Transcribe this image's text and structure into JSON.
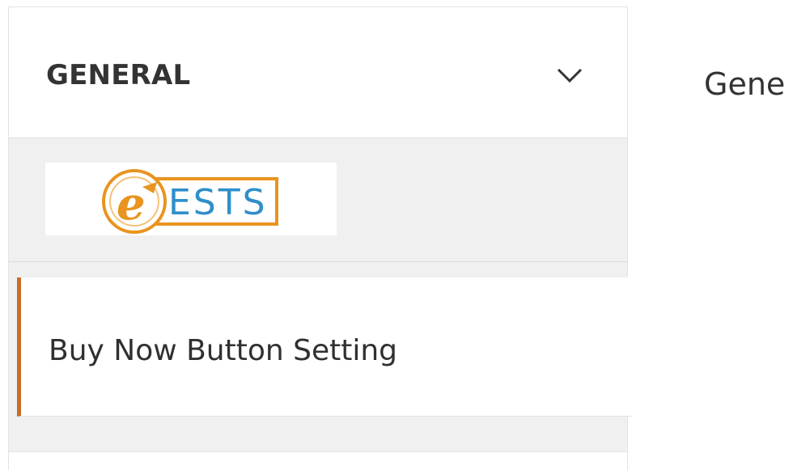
{
  "sidebar": {
    "general_section": {
      "label": "GENERAL",
      "chevron_icon": "chevron-down-icon"
    },
    "vendor_section": {
      "logo_text": "ESTS",
      "logo_letter": "e",
      "chevron_icon": "chevron-up-icon",
      "colors": {
        "logo_orange": "#e8941f",
        "logo_blue": "#2f8fc9"
      }
    },
    "sub_item": {
      "label": "Buy Now Button Setting",
      "accent_color": "#c96c2b"
    }
  },
  "main": {
    "title": "Gene"
  }
}
